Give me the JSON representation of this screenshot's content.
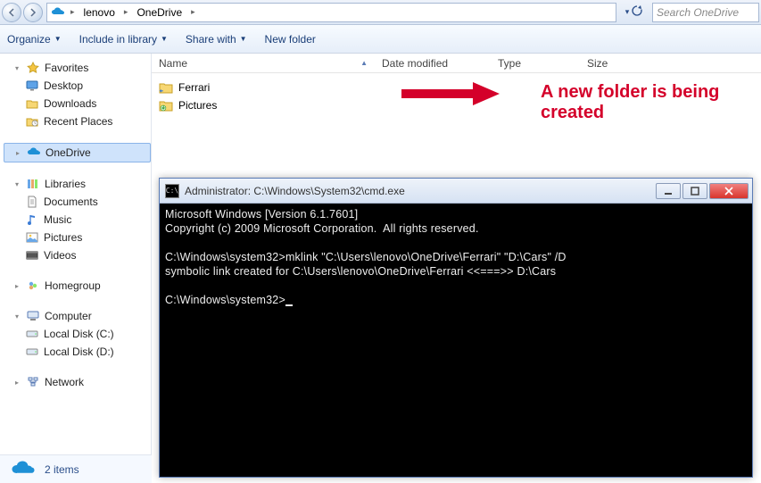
{
  "addressbar": {
    "back_tip": "Back",
    "fwd_tip": "Forward",
    "breadcrumb": [
      "lenovo",
      "OneDrive"
    ],
    "search_placeholder": "Search OneDrive"
  },
  "toolbar": {
    "organize": "Organize",
    "include": "Include in library",
    "share": "Share with",
    "newfolder": "New folder"
  },
  "navtree": {
    "favorites": {
      "label": "Favorites",
      "items": [
        "Desktop",
        "Downloads",
        "Recent Places"
      ]
    },
    "onedrive": {
      "label": "OneDrive"
    },
    "libraries": {
      "label": "Libraries",
      "items": [
        "Documents",
        "Music",
        "Pictures",
        "Videos"
      ]
    },
    "homegroup": {
      "label": "Homegroup"
    },
    "computer": {
      "label": "Computer",
      "items": [
        "Local Disk (C:)",
        "Local Disk (D:)"
      ]
    },
    "network": {
      "label": "Network"
    }
  },
  "columns": {
    "name": "Name",
    "date": "Date modified",
    "type": "Type",
    "size": "Size"
  },
  "files": [
    {
      "name": "Ferrari",
      "kind": "folder-link"
    },
    {
      "name": "Pictures",
      "kind": "folder-sync"
    }
  ],
  "annotation": {
    "text": "A new folder is being created"
  },
  "statusbar": {
    "count": "2 items"
  },
  "cmd": {
    "title": "Administrator: C:\\Windows\\System32\\cmd.exe",
    "lines": [
      "Microsoft Windows [Version 6.1.7601]",
      "Copyright (c) 2009 Microsoft Corporation.  All rights reserved.",
      "",
      "C:\\Windows\\system32>mklink \"C:\\Users\\lenovo\\OneDrive\\Ferrari\" \"D:\\Cars\" /D",
      "symbolic link created for C:\\Users\\lenovo\\OneDrive\\Ferrari <<===>> D:\\Cars",
      "",
      "C:\\Windows\\system32>"
    ]
  }
}
